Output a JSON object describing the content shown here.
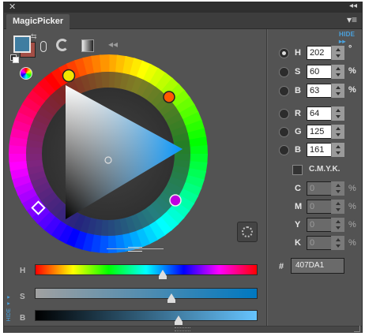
{
  "window": {
    "close_glyph": "✕",
    "collapse_glyph": "◂◂"
  },
  "tab": {
    "title": "MagicPicker",
    "menu_glyph": "▾≡"
  },
  "hide_label": "HIDE ▸▸",
  "colors": {
    "foreground": "#407DA1",
    "background": "#A34E45",
    "hue_marker": "#FF5A00",
    "accent": "#4AA3DF"
  },
  "icons": [
    "swap-icon",
    "link-lock-icon",
    "ring-mode-icon",
    "gradient-mode-icon",
    "rewind-icon",
    "color-wheel-icon",
    "target-icon"
  ],
  "toolbar": {
    "rewind_glyph": "◂◂",
    "swap_glyph": "⇆"
  },
  "sliders": {
    "h": {
      "label": "H",
      "value_fraction": 0.561
    },
    "s": {
      "label": "S",
      "value_fraction": 0.6
    },
    "b": {
      "label": "B",
      "value_fraction": 0.63
    },
    "side_label": "HIDE ◂◂"
  },
  "hsb": {
    "h": {
      "label": "H",
      "value": "202",
      "unit": "°"
    },
    "s": {
      "label": "S",
      "value": "60",
      "unit": "%"
    },
    "b": {
      "label": "B",
      "value": "63",
      "unit": "%"
    },
    "selected": "H"
  },
  "rgb": {
    "r": {
      "label": "R",
      "value": "64"
    },
    "g": {
      "label": "G",
      "value": "125"
    },
    "b": {
      "label": "B",
      "value": "161"
    }
  },
  "cmyk": {
    "label": "C.M.Y.K.",
    "c": {
      "label": "C",
      "value": "0",
      "unit": "%"
    },
    "m": {
      "label": "M",
      "value": "0",
      "unit": "%"
    },
    "y": {
      "label": "Y",
      "value": "0",
      "unit": "%"
    },
    "k": {
      "label": "K",
      "value": "0",
      "unit": "%"
    }
  },
  "hex": {
    "label": "#",
    "value": "407DA1"
  }
}
